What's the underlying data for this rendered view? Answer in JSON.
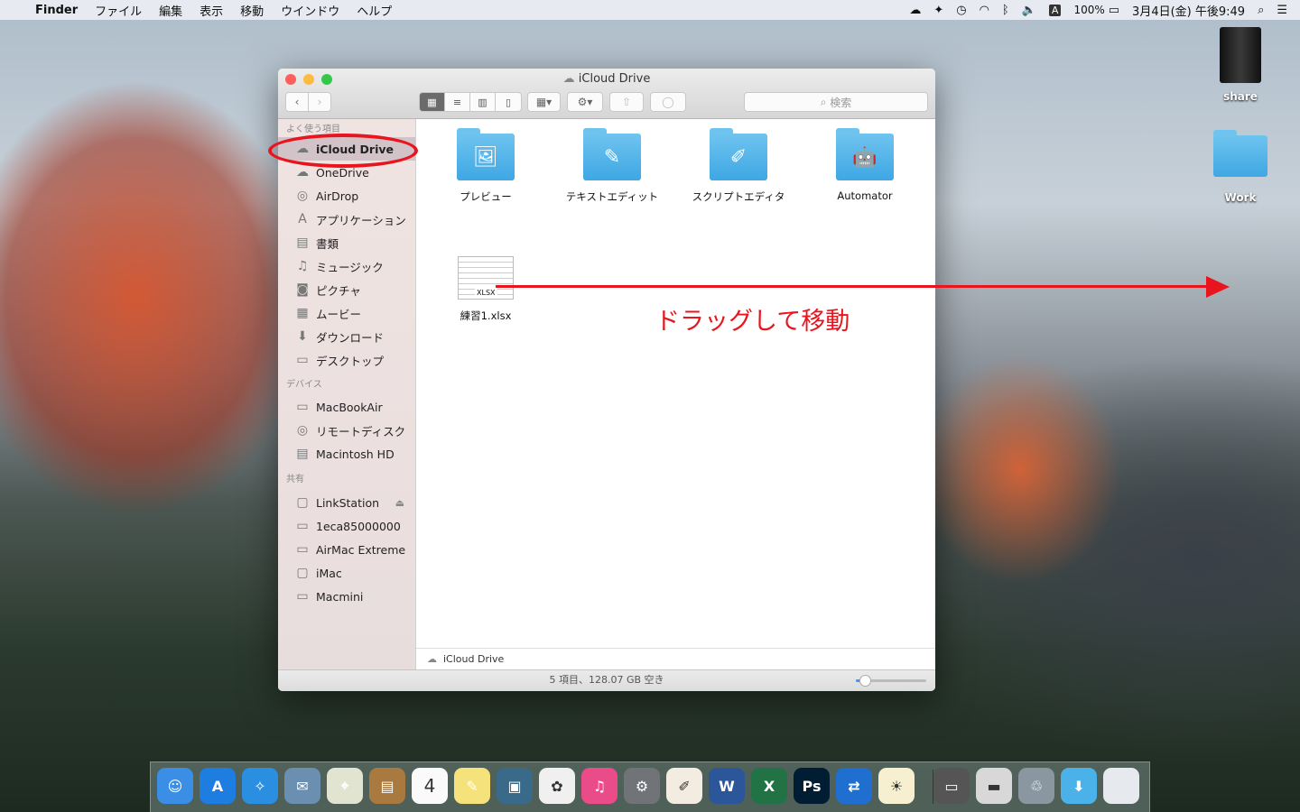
{
  "menubar": {
    "app": "Finder",
    "menus": [
      "ファイル",
      "編集",
      "表示",
      "移動",
      "ウインドウ",
      "ヘルプ"
    ],
    "input_mode": "A",
    "battery": "100%",
    "datetime": "3月4日(金) 午後9:49"
  },
  "desktop": {
    "icons": [
      {
        "label": "share"
      },
      {
        "label": "Work"
      }
    ]
  },
  "window": {
    "title": "iCloud Drive",
    "search_placeholder": "検索",
    "sidebar": {
      "favorites_header": "よく使う項目",
      "favorites": [
        {
          "label": "iCloud Drive",
          "icon": "cloud-icon"
        },
        {
          "label": "OneDrive",
          "icon": "onedrive-icon"
        },
        {
          "label": "AirDrop",
          "icon": "airdrop-icon"
        },
        {
          "label": "アプリケーション",
          "icon": "applications-icon"
        },
        {
          "label": "書類",
          "icon": "documents-icon"
        },
        {
          "label": "ミュージック",
          "icon": "music-icon"
        },
        {
          "label": "ピクチャ",
          "icon": "camera-icon"
        },
        {
          "label": "ムービー",
          "icon": "film-icon"
        },
        {
          "label": "ダウンロード",
          "icon": "download-icon"
        },
        {
          "label": "デスクトップ",
          "icon": "desktop-icon"
        }
      ],
      "devices_header": "デバイス",
      "devices": [
        {
          "label": "MacBookAir"
        },
        {
          "label": "リモートディスク"
        },
        {
          "label": "Macintosh HD"
        }
      ],
      "shared_header": "共有",
      "shared": [
        {
          "label": "LinkStation"
        },
        {
          "label": "1eca85000000"
        },
        {
          "label": "AirMac Extreme"
        },
        {
          "label": "iMac"
        },
        {
          "label": "Macmini"
        }
      ]
    },
    "items": [
      {
        "label": "プレビュー"
      },
      {
        "label": "テキストエディット"
      },
      {
        "label": "スクリプトエディタ"
      },
      {
        "label": "Automator"
      },
      {
        "label": "練習1.xlsx",
        "badge": "XLSX"
      }
    ],
    "path": "iCloud Drive",
    "status": "5 項目、128.07 GB 空き",
    "icon_size_slider": 0.1
  },
  "annotation": {
    "text": "ドラッグして移動",
    "color": "#e8141e"
  },
  "dock": [
    "Finder",
    "App Store",
    "Safari",
    "Mail",
    "Maps",
    "Contacts",
    "Calendar",
    "Notes",
    "Image Capture",
    "Photos",
    "iTunes",
    "System Preferences",
    "Pages",
    "Word",
    "Excel",
    "Photoshop",
    "Remote Desktop",
    "Dashboard",
    "iMac",
    "Mac mini",
    "Downloads server",
    "Downloads",
    "Trash"
  ],
  "dock_calendar_day": "4"
}
